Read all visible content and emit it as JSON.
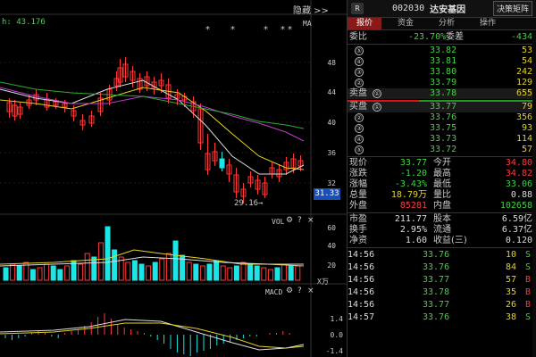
{
  "header": {
    "time_prefix": "h: 43.176",
    "hide_label": "隐藏 >>",
    "ma_label": "MA",
    "vol_label": "VOL",
    "macd_label": "MACD",
    "unit_label": "X万",
    "current_price_tag": "31.33",
    "low_annotation": "29.16",
    "price_axis": [
      "48",
      "44",
      "40",
      "36",
      "32"
    ],
    "vol_axis": [
      "60",
      "40",
      "20"
    ],
    "macd_axis": [
      "1.4",
      "0.0",
      "-1.4",
      "-2.8"
    ],
    "stars": [
      "*",
      "*",
      "*",
      "*",
      "*"
    ]
  },
  "panel": {
    "badge": "R",
    "code": "002030",
    "name": "达安基因",
    "decision_button": "决策矩阵",
    "tabs": [
      "报价",
      "资金",
      "分析",
      "操作"
    ],
    "ratio": {
      "label": "委比",
      "value": "-23.70%",
      "label2": "委差",
      "value2": "-434"
    },
    "sell_levels": [
      {
        "idx": "⑤",
        "price": "33.82",
        "vol": "53"
      },
      {
        "idx": "④",
        "price": "33.81",
        "vol": "54"
      },
      {
        "idx": "③",
        "price": "33.80",
        "vol": "242"
      },
      {
        "idx": "②",
        "price": "33.79",
        "vol": "129"
      },
      {
        "label": "卖盘",
        "idx": "①",
        "price": "33.78",
        "vol": "655"
      }
    ],
    "buy_levels": [
      {
        "label": "买盘",
        "idx": "①",
        "price": "33.77",
        "vol": "79"
      },
      {
        "idx": "②",
        "price": "33.76",
        "vol": "356"
      },
      {
        "idx": "③",
        "price": "33.75",
        "vol": "93"
      },
      {
        "idx": "④",
        "price": "33.73",
        "vol": "114"
      },
      {
        "idx": "⑤",
        "price": "33.72",
        "vol": "57"
      }
    ],
    "stats": [
      {
        "l1": "现价",
        "v1": "33.77",
        "c1": "g",
        "l2": "今开",
        "v2": "34.80",
        "c2": "r"
      },
      {
        "l1": "涨跌",
        "v1": "-1.20",
        "c1": "g",
        "l2": "最高",
        "v2": "34.82",
        "c2": "r"
      },
      {
        "l1": "涨幅",
        "v1": "-3.43%",
        "c1": "g",
        "l2": "最低",
        "v2": "33.06",
        "c2": "g"
      },
      {
        "l1": "总量",
        "v1": "18.79万",
        "c1": "y",
        "l2": "量比",
        "v2": "0.88",
        "c2": "w"
      },
      {
        "l1": "外盘",
        "v1": "85281",
        "c1": "r",
        "l2": "内盘",
        "v2": "102658",
        "c2": "g"
      }
    ],
    "stats2": [
      {
        "l1": "市盈",
        "v1": "211.77",
        "l2": "股本",
        "v2": "6.59亿"
      },
      {
        "l1": "换手",
        "v1": "2.95%",
        "l2": "流通",
        "v2": "6.37亿"
      },
      {
        "l1": "净资",
        "v1": "1.60",
        "l2": "收益(三)",
        "v2": "0.120"
      }
    ],
    "ticks": [
      {
        "time": "14:56",
        "price": "33.76",
        "vol": "10",
        "side": "S"
      },
      {
        "time": "14:56",
        "price": "33.76",
        "vol": "84",
        "side": "S"
      },
      {
        "time": "14:56",
        "price": "33.77",
        "vol": "57",
        "side": "B"
      },
      {
        "time": "14:56",
        "price": "33.78",
        "vol": "35",
        "side": "B"
      },
      {
        "time": "14:56",
        "price": "33.77",
        "vol": "26",
        "side": "B"
      },
      {
        "time": "14:57",
        "price": "33.76",
        "vol": "38",
        "side": "S"
      }
    ]
  },
  "colors": {
    "up": "#ff3a3a",
    "down": "#1ee5e5",
    "green": "#3ed53e",
    "yellow": "#e6d323",
    "ma_white": "#dddddd",
    "ma_purple": "#c03cd0",
    "ma_green": "#2faa2f"
  }
}
